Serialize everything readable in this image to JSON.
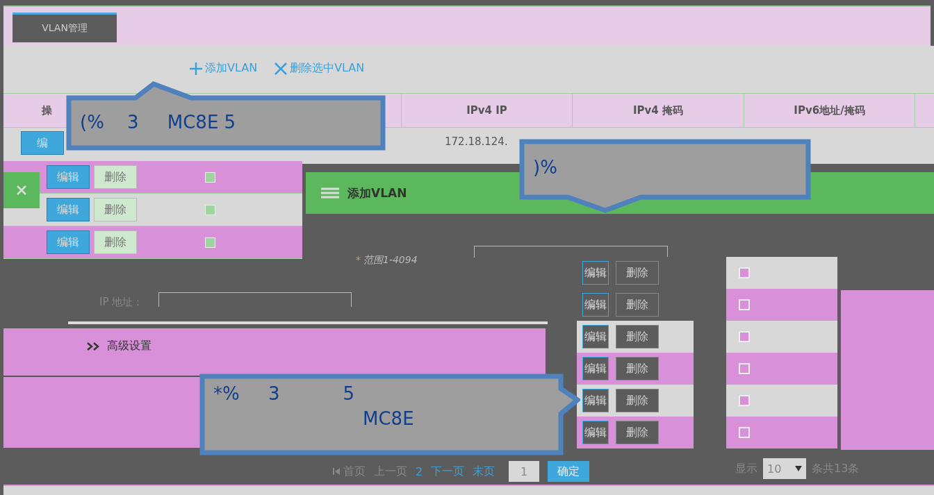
{
  "tab": {
    "label": "VLAN管理",
    "selected": true
  },
  "toolbar": [
    {
      "label": "添加VLAN",
      "kind": "add"
    },
    {
      "label": "删除选中VLAN",
      "kind": "delete"
    }
  ],
  "table": {
    "columns": [
      "操",
      "IPv4 IP",
      "IPv4 掩码",
      "IPv6地址/掩码"
    ],
    "first_row": {
      "action": "编",
      "ipv4_ip": "172.18.124."
    },
    "rows": [
      {
        "edit": "编辑",
        "delete": "删除",
        "checked": false
      },
      {
        "edit": "编辑",
        "delete": "删除",
        "checked": false
      },
      {
        "edit": "编辑",
        "delete": "删除",
        "checked": false
      }
    ]
  },
  "dialog": {
    "title": "添加VLAN",
    "required_mark": "*",
    "range_hint": "范围1-4094",
    "ip_label": "IP 地址：",
    "advanced": "高级设置"
  },
  "callouts": [
    {
      "kind": "up",
      "lines": [
        "(%    3     MC8E 5"
      ]
    },
    {
      "kind": "down",
      "lines": [
        ")%"
      ]
    },
    {
      "kind": "right",
      "lines": [
        "*%     3           5",
        "MC8E"
      ]
    }
  ],
  "right_rows": [
    {
      "edit": "编辑",
      "delete": "删除",
      "checked": false
    },
    {
      "edit": "编辑",
      "delete": "删除",
      "checked": false
    },
    {
      "edit": "编辑",
      "delete": "删除",
      "checked": false
    },
    {
      "edit": "编辑",
      "delete": "删除",
      "checked": false
    },
    {
      "edit": "编辑",
      "delete": "删除",
      "checked": false
    },
    {
      "edit": "编辑",
      "delete": "删除",
      "checked": false
    }
  ],
  "pagination": {
    "first": "首页",
    "prev": "上一页",
    "page": "2",
    "next": "下一页",
    "last": "末页",
    "page_input": "1",
    "confirm": "确定",
    "show": "显示",
    "page_size": "10",
    "total": "条共13条"
  }
}
